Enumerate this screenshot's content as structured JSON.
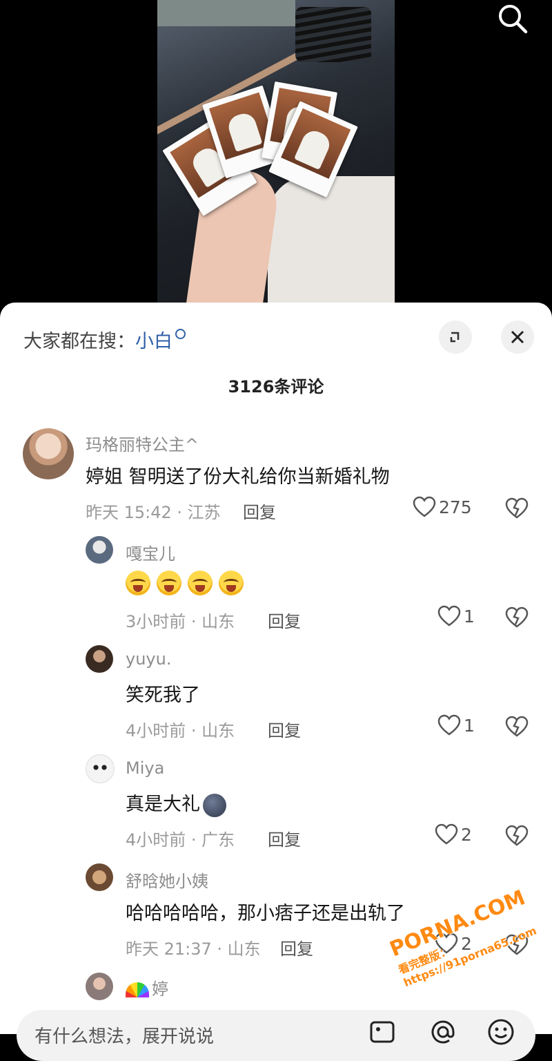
{
  "hot_search": {
    "prefix": "大家都在搜：",
    "keyword": "小白"
  },
  "comment_count": "3126条评论",
  "comments": [
    {
      "user": "玛格丽特公主^",
      "text": "婷姐 智明送了份大礼给你当新婚礼物",
      "time": "昨天 15:42 · 江苏",
      "reply": "回复",
      "likes": "275"
    },
    {
      "user": "嘎宝儿",
      "emoji_count": 4,
      "time": "3小时前 · 山东",
      "reply": "回复",
      "likes": "1"
    },
    {
      "user": "yuyu.",
      "text": "笑死我了",
      "time": "4小时前 · 山东",
      "reply": "回复",
      "likes": "1"
    },
    {
      "user": "Miya",
      "text": "真是大礼",
      "time": "4小时前 · 广东",
      "reply": "回复",
      "likes": "2"
    },
    {
      "user": "舒晗她小姨",
      "text": "哈哈哈哈哈，那小痞子还是出轨了",
      "time": "昨天 21:37 · 山东",
      "reply": "回复",
      "likes": "2"
    },
    {
      "user": "婷"
    }
  ],
  "input": {
    "placeholder": "有什么想法，展开说说"
  },
  "watermark": {
    "brand": "PORNA.COM",
    "tagline": "看完整版：https://91porna65.com"
  },
  "colors": {
    "keyword": "#2f5fa8",
    "watermark": "#ff8a12"
  }
}
